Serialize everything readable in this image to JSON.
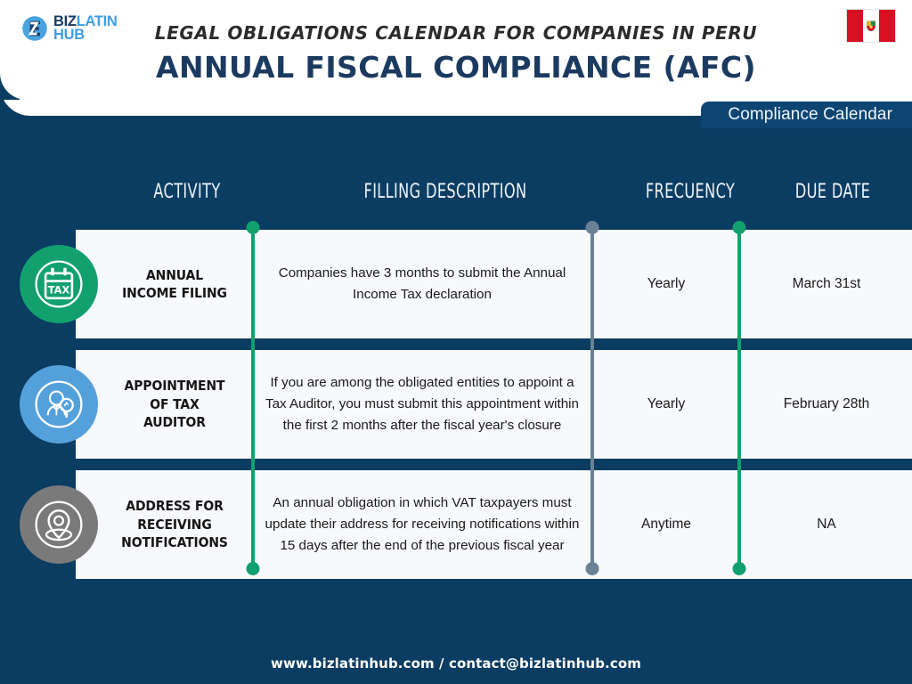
{
  "header": {
    "logo": {
      "mark": "biz-latin-hub-logo-icon",
      "biz": "BIZ",
      "latin": "LATIN",
      "hub": "HUB"
    },
    "subtitle": "LEGAL OBLIGATIONS CALENDAR FOR COMPANIES IN PERU",
    "title": "ANNUAL FISCAL COMPLIANCE (AFC)",
    "flag": "peru-flag-icon",
    "tab_label": "Compliance Calendar"
  },
  "table": {
    "columns": [
      "ACTIVITY",
      "FILLING DESCRIPTION",
      "FRECUENCY",
      "DUE DATE"
    ],
    "rows": [
      {
        "icon": "tax-calendar-icon",
        "icon_color": "#12a06f",
        "activity": "ANNUAL\nINCOME FILING",
        "description": "Companies have 3 months to submit the Annual Income Tax declaration",
        "frequency": "Yearly",
        "due_date": "March 31st"
      },
      {
        "icon": "tax-auditor-person-icon",
        "icon_color": "#54a0db",
        "activity": "APPOINTMENT\nOF TAX\nAUDITOR",
        "description": "If you are among the obligated entities to appoint a Tax Auditor, you must submit this appointment within the first 2 months after the fiscal year's closure",
        "frequency": "Yearly",
        "due_date": "February 28th"
      },
      {
        "icon": "location-pin-icon",
        "icon_color": "#7a7a7a",
        "activity": "ADDRESS FOR\nRECEIVING\nNOTIFICATIONS",
        "description": "An annual obligation in which VAT taxpayers must update their address for receiving notifications within 15 days after the end of the previous fiscal year",
        "frequency": "Anytime",
        "due_date": "NA"
      }
    ]
  },
  "connectors": [
    {
      "color": "#12a06f"
    },
    {
      "color": "#6a8196"
    },
    {
      "color": "#12a06f"
    }
  ],
  "footer": {
    "text": "www.bizlatinhub.com / contact@bizlatinhub.com"
  },
  "colors": {
    "background": "#0b3c61",
    "card": "#f7f9fc",
    "accent_green": "#12a06f",
    "accent_blue": "#54a0db",
    "accent_gray": "#7a7a7a",
    "title_navy": "#1b3a60"
  }
}
